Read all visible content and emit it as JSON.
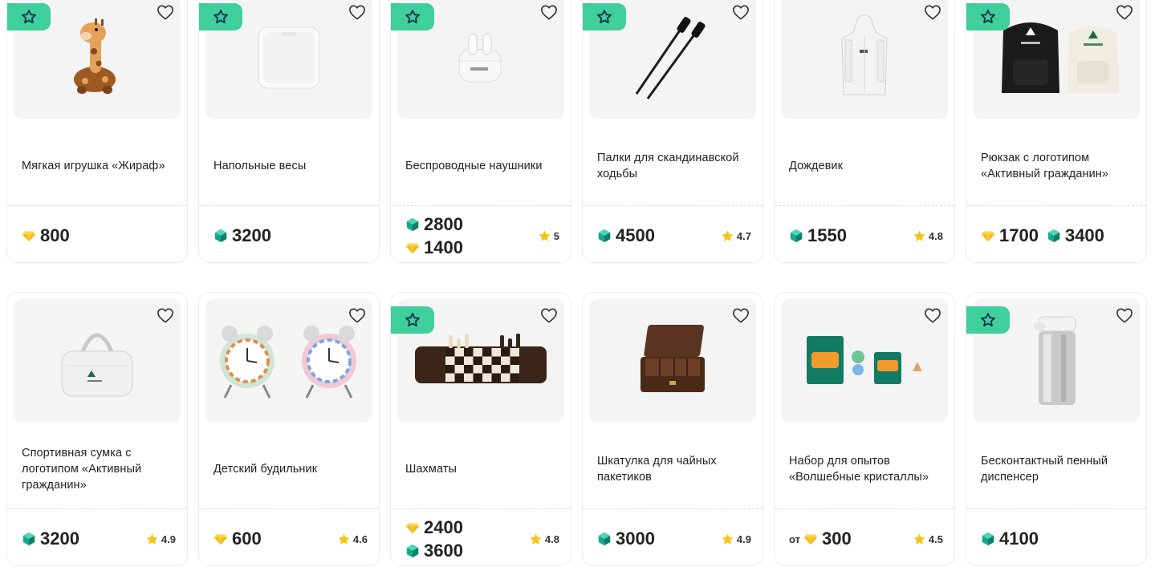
{
  "colors": {
    "badge": "#3ecf9a",
    "crystal": "#18a889",
    "diamond": "#f2b40f",
    "rating_star": "#f7c515"
  },
  "icons": {
    "badge": "star-outline-icon",
    "favorite": "heart-icon",
    "crystal": "crystal-icon",
    "diamond": "diamond-icon",
    "rating": "star-icon"
  },
  "products": [
    {
      "title": "Мягкая игрушка «Жираф»",
      "badge": true,
      "image": "giraffe",
      "prices": [
        {
          "currency": "diamond",
          "value": "800"
        }
      ],
      "rating": ""
    },
    {
      "title": "Напольные весы",
      "badge": true,
      "image": "scales",
      "prices": [
        {
          "currency": "crystal",
          "value": "3200"
        }
      ],
      "rating": ""
    },
    {
      "title": "Беспроводные наушники",
      "badge": true,
      "image": "earbuds",
      "prices": [
        {
          "currency": "crystal",
          "value": "2800"
        },
        {
          "currency": "diamond",
          "value": "1400"
        }
      ],
      "stack": true,
      "rating": "5"
    },
    {
      "title": "Палки для скандинавской ходьбы",
      "badge": true,
      "image": "poles",
      "prices": [
        {
          "currency": "crystal",
          "value": "4500"
        }
      ],
      "rating": "4.7"
    },
    {
      "title": "Дождевик",
      "badge": false,
      "image": "raincoat",
      "prices": [
        {
          "currency": "crystal",
          "value": "1550"
        }
      ],
      "rating": "4.8"
    },
    {
      "title": "Рюкзак с логотипом «Активный гражданин»",
      "badge": true,
      "image": "backpacks",
      "prices": [
        {
          "currency": "diamond",
          "value": "1700"
        },
        {
          "currency": "crystal",
          "value": "3400"
        }
      ],
      "rating": ""
    },
    {
      "title": "Спортивная сумка с логотипом «Активный гражданин»",
      "badge": false,
      "image": "bag",
      "prices": [
        {
          "currency": "crystal",
          "value": "3200"
        }
      ],
      "rating": "4.9"
    },
    {
      "title": "Детский будильник",
      "badge": false,
      "image": "clocks",
      "prices": [
        {
          "currency": "diamond",
          "value": "600"
        }
      ],
      "rating": "4.6"
    },
    {
      "title": "Шахматы",
      "badge": true,
      "image": "chess",
      "prices": [
        {
          "currency": "diamond",
          "value": "2400"
        },
        {
          "currency": "crystal",
          "value": "3600"
        }
      ],
      "stack": true,
      "rating": "4.8"
    },
    {
      "title": "Шкатулка для чайных пакетиков",
      "badge": false,
      "image": "teabox",
      "prices": [
        {
          "currency": "crystal",
          "value": "3000"
        }
      ],
      "rating": "4.9"
    },
    {
      "title": "Набор для опытов «Волшебные кристаллы»",
      "badge": false,
      "image": "crystalkit",
      "prefix": "от",
      "prices": [
        {
          "currency": "diamond",
          "value": "300"
        }
      ],
      "rating": "4.5"
    },
    {
      "title": "Бесконтактный пенный диспенсер",
      "badge": true,
      "image": "dispenser",
      "prices": [
        {
          "currency": "crystal",
          "value": "4100"
        }
      ],
      "rating": ""
    }
  ]
}
